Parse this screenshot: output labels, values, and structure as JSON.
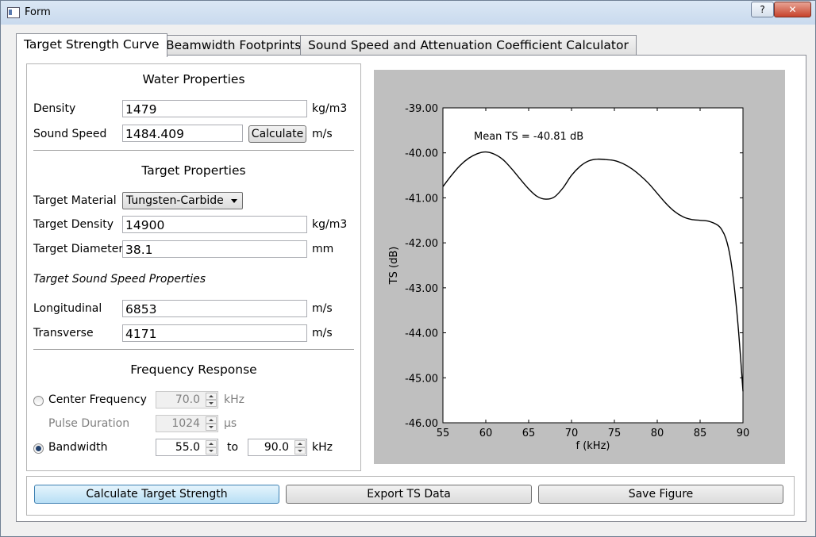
{
  "window": {
    "title": "Form",
    "help_label": "?",
    "close_label": "✕"
  },
  "tabs": [
    {
      "label": "Target Strength Curve"
    },
    {
      "label": "Beamwidth Footprints"
    },
    {
      "label": "Sound Speed and Attenuation Coefficient Calculator"
    }
  ],
  "water": {
    "heading": "Water Properties",
    "density_label": "Density",
    "density_value": "1479",
    "density_unit": "kg/m3",
    "speed_label": "Sound Speed",
    "speed_value": "1484.409",
    "calculate_label": "Calculate",
    "speed_unit": "m/s"
  },
  "target": {
    "heading": "Target Properties",
    "material_label": "Target Material",
    "material_value": "Tungsten-Carbide",
    "density_label": "Target Density",
    "density_value": "14900",
    "density_unit": "kg/m3",
    "diameter_label": "Target Diameter",
    "diameter_value": "38.1",
    "diameter_unit": "mm",
    "ss_heading": "Target Sound Speed Properties",
    "long_label": "Longitudinal",
    "long_value": "6853",
    "long_unit": "m/s",
    "trans_label": "Transverse",
    "trans_value": "4171",
    "trans_unit": "m/s"
  },
  "freq": {
    "heading": "Frequency Response",
    "center_label": "Center Frequency",
    "center_value": "70.0",
    "center_unit": "kHz",
    "center_selected": false,
    "pulse_label": "Pulse Duration",
    "pulse_value": "1024",
    "pulse_unit": "µs",
    "bw_label": "Bandwidth",
    "bw_from": "55.0",
    "bw_to_label": "to",
    "bw_to": "90.0",
    "bw_unit": "kHz",
    "bw_selected": true
  },
  "buttons": {
    "calc": "Calculate Target Strength",
    "export": "Export TS Data",
    "save": "Save Figure"
  },
  "chart_data": {
    "type": "line",
    "xlabel": "f (kHz)",
    "ylabel": "TS (dB)",
    "xlim": [
      55,
      90
    ],
    "ylim": [
      -46.0,
      -39.0
    ],
    "xticks": [
      "55",
      "60",
      "65",
      "70",
      "75",
      "80",
      "85",
      "90"
    ],
    "yticks": [
      "-39.00",
      "-40.00",
      "-41.00",
      "-42.00",
      "-43.00",
      "-44.00",
      "-45.00",
      "-46.00"
    ],
    "annotation": "Mean TS = -40.81 dB",
    "grid": false,
    "line_color": "#000000",
    "background": "#bfbfbf",
    "series": [
      {
        "x": [
          55,
          56,
          57,
          58,
          59,
          60,
          61,
          62,
          63,
          64,
          65,
          66,
          67,
          68,
          69,
          70,
          71,
          72,
          73,
          74,
          75,
          76,
          77,
          78,
          79,
          80,
          81,
          82,
          83,
          84,
          85,
          86,
          87,
          87.5,
          88,
          88.5,
          89,
          89.5,
          90
        ],
        "y": [
          -40.75,
          -40.5,
          -40.28,
          -40.12,
          -40.02,
          -39.98,
          -40.03,
          -40.15,
          -40.35,
          -40.58,
          -40.8,
          -40.97,
          -41.03,
          -40.98,
          -40.78,
          -40.5,
          -40.3,
          -40.18,
          -40.14,
          -40.15,
          -40.17,
          -40.24,
          -40.35,
          -40.5,
          -40.68,
          -40.9,
          -41.12,
          -41.3,
          -41.42,
          -41.48,
          -41.5,
          -41.52,
          -41.6,
          -41.7,
          -41.9,
          -42.3,
          -43.0,
          -44.0,
          -45.3
        ]
      }
    ]
  }
}
